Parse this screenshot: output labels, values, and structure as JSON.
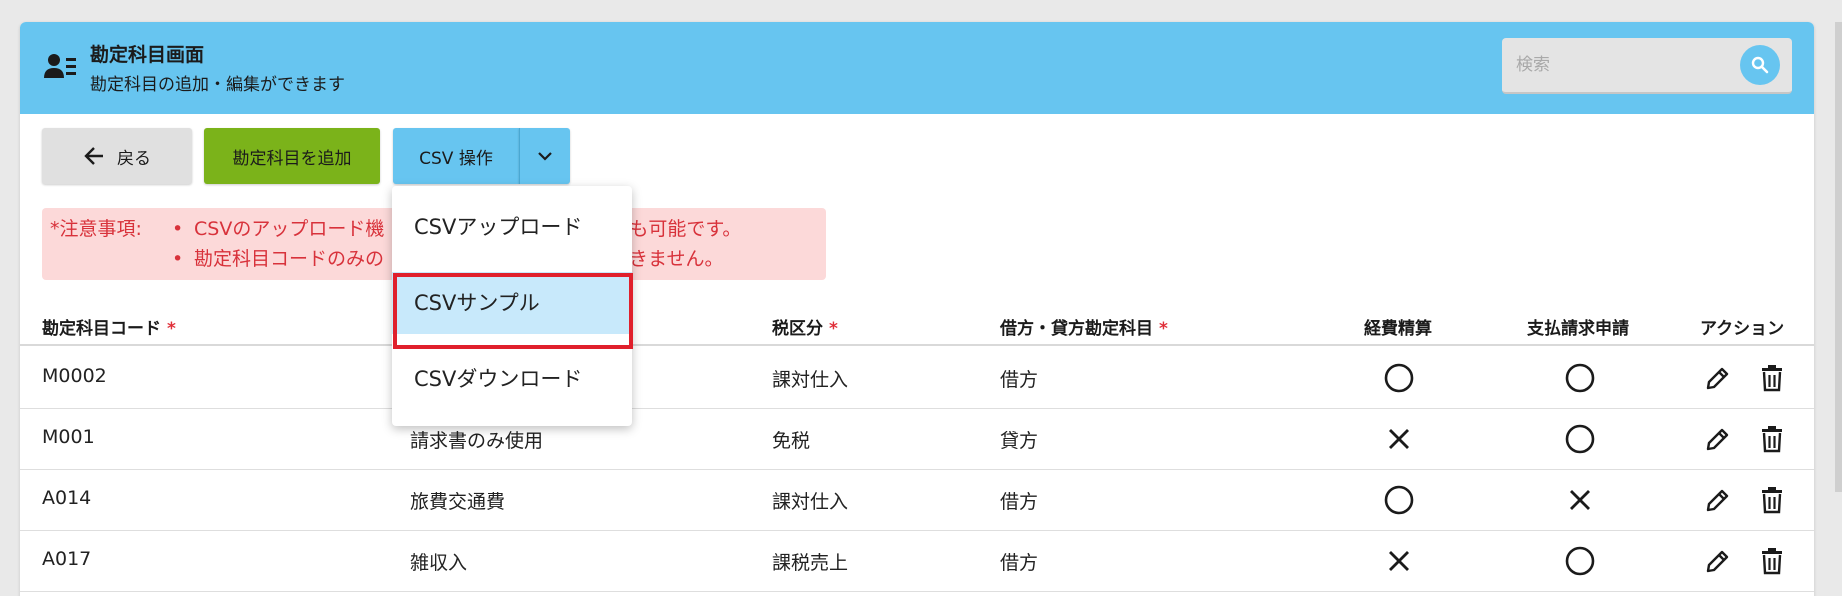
{
  "header": {
    "title": "勘定科目画面",
    "subtitle": "勘定科目の追加・編集ができます",
    "icon": "user-list-icon"
  },
  "search": {
    "placeholder": "検索",
    "icon": "search-icon"
  },
  "toolbar": {
    "back_label": "戻る",
    "add_label": "勘定科目を追加",
    "csv_label": "CSV 操作"
  },
  "notice": {
    "label": "*注意事項:",
    "lines": [
      "CSVのアップロード機能は追加、更新どちらも可能です。",
      "勘定科目コードのみの変更はCSVではできません。"
    ],
    "visible_lines": [
      [
        "CSVのアップロード機",
        "どちらも可能です。"
      ],
      [
        "勘定科目コードのみの",
        "ではできません。"
      ]
    ]
  },
  "table": {
    "headers": {
      "code": "勘定科目コード",
      "name": "",
      "tax": "税区分",
      "dc": "借方・貸方勘定科目",
      "expense": "経費精算",
      "payment": "支払請求申請",
      "action": "アクション"
    },
    "required_mark": "*",
    "rows": [
      {
        "code": "M0002",
        "name": "",
        "tax": "課対仕入",
        "dc": "借方",
        "expense": "○",
        "payment": "○"
      },
      {
        "code": "M001",
        "name": "請求書のみ使用",
        "tax": "免税",
        "dc": "貸方",
        "expense": "×",
        "payment": "○"
      },
      {
        "code": "A014",
        "name": "旅費交通費",
        "tax": "課対仕入",
        "dc": "借方",
        "expense": "○",
        "payment": "×"
      },
      {
        "code": "A017",
        "name": "雑収入",
        "tax": "課税売上",
        "dc": "借方",
        "expense": "×",
        "payment": "○"
      }
    ]
  },
  "csv_menu": {
    "items": [
      "CSVアップロード",
      "CSVサンプル",
      "CSVダウンロード"
    ],
    "selected": "CSVサンプル"
  },
  "colors": {
    "header_bg": "#67c5f0",
    "add_button": "#7bb31a",
    "notice_bg": "#fcd9d9",
    "notice_text": "#d8323b",
    "highlight": "#e0202c",
    "menu_active": "#c8e9fb"
  }
}
